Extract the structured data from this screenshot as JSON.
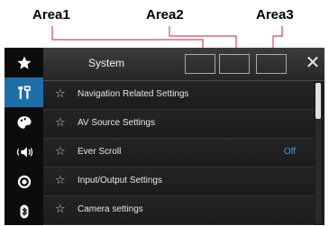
{
  "callouts": {
    "area1": "Area1",
    "area2": "Area2",
    "area3": "Area3"
  },
  "header": {
    "title": "System",
    "close_glyph": "✕",
    "close_icon": "close-icon"
  },
  "sidebar": {
    "items": [
      {
        "name": "favorites",
        "icon": "star-icon",
        "active": false
      },
      {
        "name": "settings",
        "icon": "tools-icon",
        "active": true
      },
      {
        "name": "navigation",
        "icon": "theme-icon",
        "active": false
      },
      {
        "name": "audio",
        "icon": "speaker-icon",
        "active": false
      },
      {
        "name": "av-source",
        "icon": "record-icon",
        "active": false
      },
      {
        "name": "bluetooth",
        "icon": "bluetooth-icon",
        "active": false
      }
    ]
  },
  "list": {
    "rows": [
      {
        "label": "Navigation Related Settings",
        "value": ""
      },
      {
        "label": "AV Source Settings",
        "value": ""
      },
      {
        "label": "Ever Scroll",
        "value": "Off"
      },
      {
        "label": "Input/Output Settings",
        "value": ""
      },
      {
        "label": "Camera settings",
        "value": ""
      }
    ],
    "star_glyph": "☆",
    "scroll_fraction": 0.0
  },
  "colors": {
    "active_tab": "#1e6fa8",
    "value_text": "#3e9be6",
    "callout_line": "#e0445a"
  }
}
